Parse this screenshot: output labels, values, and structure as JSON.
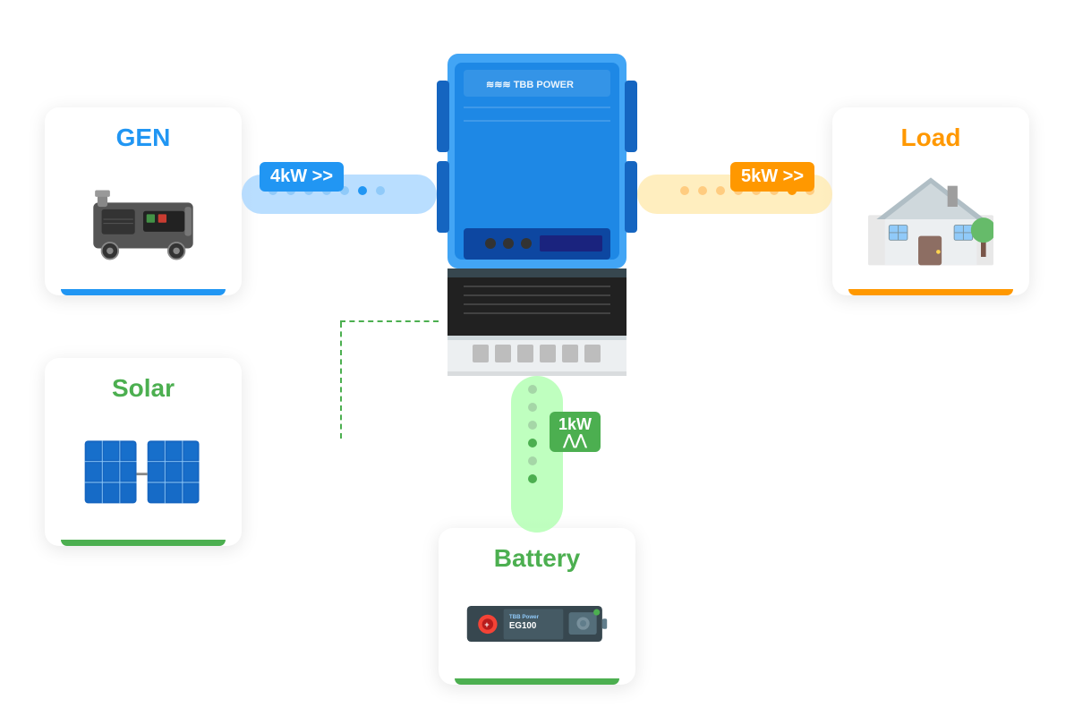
{
  "cards": {
    "gen": {
      "title": "GEN",
      "title_color": "#2196F3",
      "bar_color": "#2196F3"
    },
    "solar": {
      "title": "Solar",
      "title_color": "#4CAF50",
      "bar_color": "#4CAF50"
    },
    "load": {
      "title": "Load",
      "title_color": "#FF9800",
      "bar_color": "#FF9800"
    },
    "battery": {
      "title": "Battery",
      "title_color": "#4CAF50",
      "bar_color": "#4CAF50"
    }
  },
  "badges": {
    "gen": {
      "label": "4kW >>",
      "bg": "#2196F3"
    },
    "load": {
      "label": "5kW >>",
      "bg": "#FF9800"
    },
    "battery": {
      "label": "1kW",
      "bg": "#4CAF50"
    }
  },
  "inverter": {
    "brand": "TBB POWER"
  }
}
